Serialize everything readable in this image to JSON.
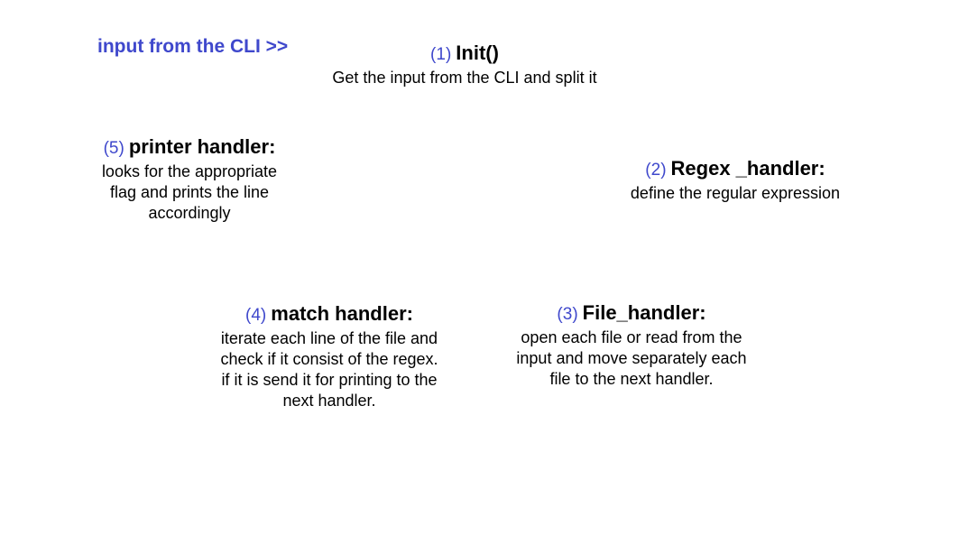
{
  "cli_label": "input from the CLI >>",
  "colors": {
    "accent_blue": "#3f48cc",
    "text": "#000000",
    "background": "#ffffff"
  },
  "nodes": {
    "init": {
      "number": "(1)",
      "title": "Init()",
      "desc": [
        "Get the input from the CLI and split it"
      ]
    },
    "regex": {
      "number": "(2)",
      "title": "Regex _handler:",
      "desc": [
        "define the regular expression"
      ]
    },
    "file": {
      "number": "(3)",
      "title": "File_handler:",
      "desc": [
        "open each file or read from the",
        "input and move separately each",
        "file to the next handler."
      ]
    },
    "match": {
      "number": "(4)",
      "title": "match handler:",
      "desc": [
        "iterate each line of the file and",
        "check if it consist of the regex.",
        "if it is send it for printing to the",
        "next handler."
      ]
    },
    "printer": {
      "number": "(5)",
      "title": "printer handler:",
      "desc": [
        "looks for the appropriate",
        "flag and prints the line",
        "accordingly"
      ]
    }
  }
}
